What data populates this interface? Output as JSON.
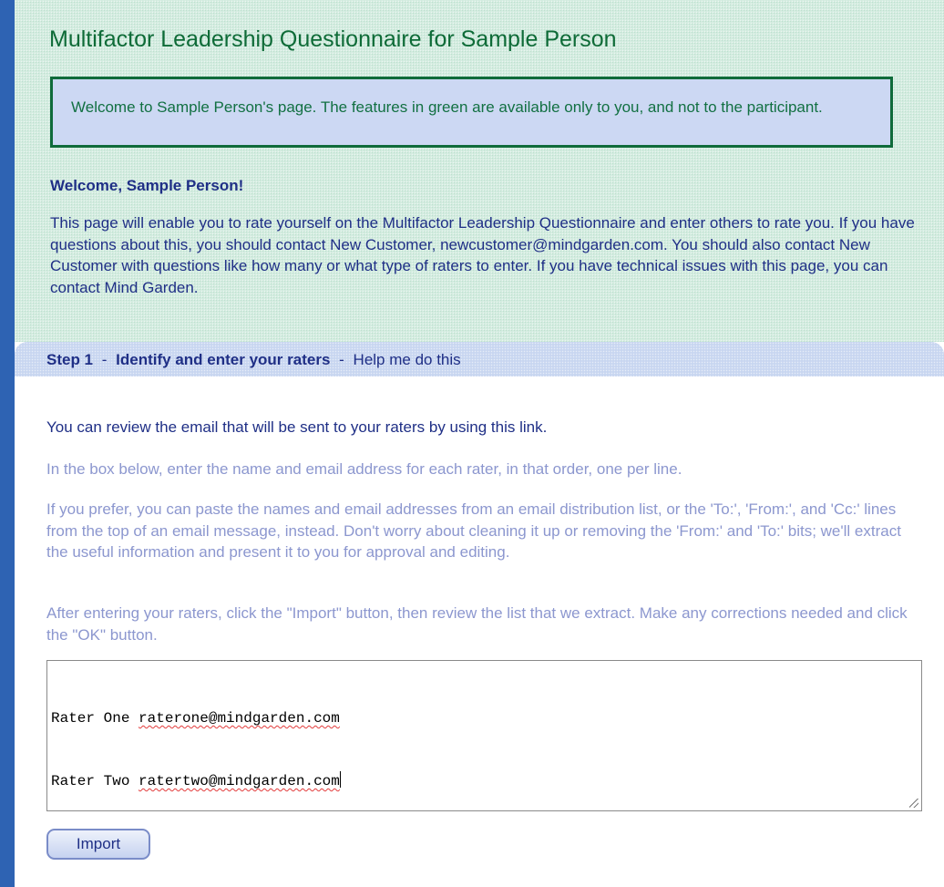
{
  "header": {
    "title": "Multifactor Leadership Questionnaire for Sample Person"
  },
  "notice": {
    "text": "Welcome to Sample Person's page. The features in green are available only to you, and not to the participant."
  },
  "welcome": {
    "heading": "Welcome, Sample Person!",
    "body": "This page will enable you to rate yourself on the Multifactor Leadership Questionnaire and enter others to rate you. If you have questions about this, you should contact New Customer, newcustomer@mindgarden.com. You should also contact New Customer with questions like how many or what type of raters to enter. If you have technical issues with this page, you can contact Mind Garden."
  },
  "step": {
    "label": "Step 1",
    "separator1": "-",
    "title": "Identify and enter your raters",
    "separator2": "-",
    "help_link": "Help me do this"
  },
  "instructions": {
    "review_email": "You can review the email that will be sent to your raters by using this link.",
    "box_instruction": "In the box below, enter the name and email address for each rater, in that order, one per line.",
    "paste_instruction": "If you prefer, you can paste the names and email addresses from an email distribution list, or the 'To:', 'From:', and 'Cc:' lines from the top of an email message, instead. Don't worry about cleaning it up or removing the 'From:' and 'To:' bits; we'll extract the useful information and present it to you for approval and editing.",
    "import_instruction": "After entering your raters, click the \"Import\" button, then review the list that we extract. Make any corrections needed and click the \"OK\" button."
  },
  "raters_input": {
    "lines": [
      {
        "name": "Rater One",
        "email": "raterone@mindgarden.com"
      },
      {
        "name": "Rater Two",
        "email": "ratertwo@mindgarden.com"
      }
    ]
  },
  "actions": {
    "import_label": "Import"
  },
  "colors": {
    "frame_blue": "#2e63b3",
    "owner_green_bg": "#d3ece0",
    "green_text": "#0e6b37",
    "navy_text": "#1f2f86",
    "muted_text": "#8c97cf",
    "notice_bg": "#ccd8f3"
  }
}
